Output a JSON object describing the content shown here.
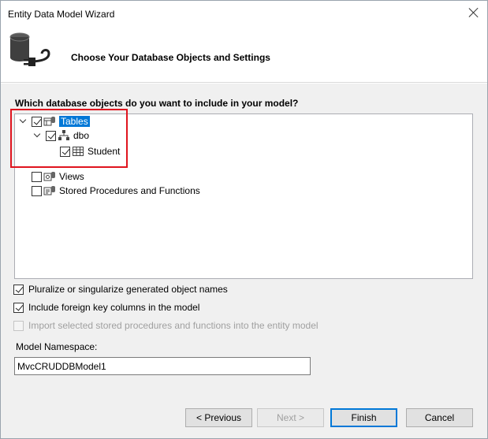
{
  "window": {
    "title": "Entity Data Model Wizard"
  },
  "header": {
    "title": "Choose Your Database Objects and Settings",
    "icon": "database-plug-icon"
  },
  "question": "Which database objects do you want to include in your model?",
  "tree": {
    "tables": {
      "label": "Tables",
      "checked": true,
      "expanded": true,
      "selected": true
    },
    "dbo": {
      "label": "dbo",
      "checked": true,
      "expanded": true
    },
    "student": {
      "label": "Student",
      "checked": true
    },
    "views": {
      "label": "Views",
      "checked": false
    },
    "stored": {
      "label": "Stored Procedures and Functions",
      "checked": false
    }
  },
  "options": {
    "pluralize": {
      "label": "Pluralize or singularize generated object names",
      "checked": true
    },
    "foreign_keys": {
      "label": "Include foreign key columns in the model",
      "checked": true
    },
    "import_procs": {
      "label": "Import selected stored procedures and functions into the entity model",
      "checked": false,
      "disabled": true
    }
  },
  "namespace": {
    "label": "Model Namespace:",
    "value": "MvcCRUDDBModel1"
  },
  "buttons": {
    "previous": "< Previous",
    "next": "Next >",
    "finish": "Finish",
    "cancel": "Cancel"
  },
  "colors": {
    "selection": "#0078d7",
    "highlight_box": "#e0141e"
  }
}
